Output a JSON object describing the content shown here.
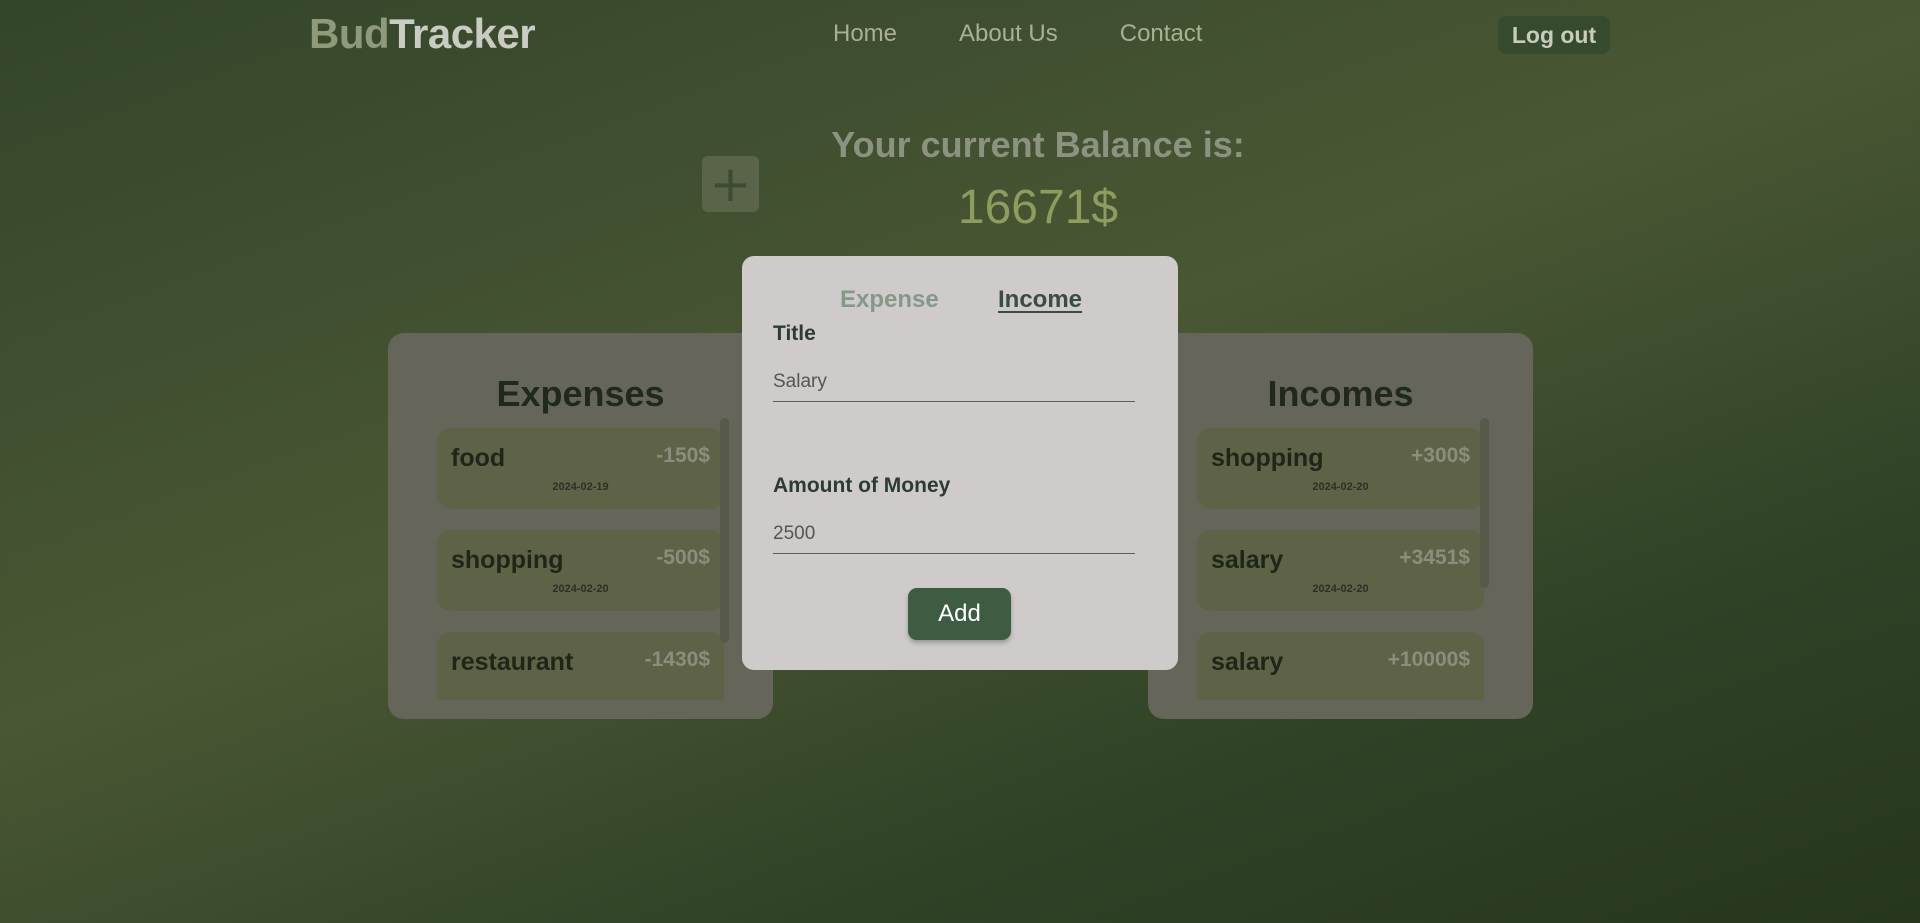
{
  "header": {
    "logo_part1": "Bud",
    "logo_part2": "Tracker",
    "nav": [
      "Home",
      "About Us",
      "Contact"
    ],
    "logout_label": "Log out"
  },
  "balance": {
    "label": "Your current Balance is:",
    "value": "16671$",
    "add_icon": "+"
  },
  "expenses": {
    "title": "Expenses",
    "items": [
      {
        "title": "food",
        "amount": "-150$",
        "date": "2024-02-19"
      },
      {
        "title": "shopping",
        "amount": "-500$",
        "date": "2024-02-20"
      },
      {
        "title": "restaurant",
        "amount": "-1430$",
        "date": ""
      }
    ]
  },
  "incomes": {
    "title": "Incomes",
    "items": [
      {
        "title": "shopping",
        "amount": "+300$",
        "date": "2024-02-20"
      },
      {
        "title": "salary",
        "amount": "+3451$",
        "date": "2024-02-20"
      },
      {
        "title": "salary",
        "amount": "+10000$",
        "date": ""
      }
    ]
  },
  "modal": {
    "tab_expense": "Expense",
    "tab_income": "Income",
    "title_label": "Title",
    "title_value": "Salary",
    "amount_label": "Amount of Money",
    "amount_value": "2500",
    "add_label": "Add"
  },
  "colors": {
    "accent": "#3e5c41",
    "balance": "#8e9c5e",
    "modal_bg": "#cfcbcb"
  }
}
